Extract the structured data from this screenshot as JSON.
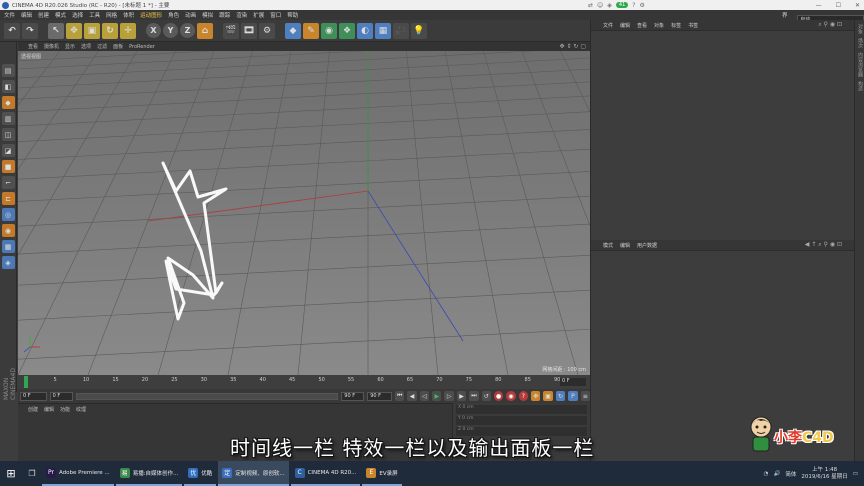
{
  "window": {
    "title": "CINEMA 4D R20.026 Studio (RC - R20) - [未标题 1 *] - 主要"
  },
  "menu": {
    "items": [
      "文件",
      "编辑",
      "创建",
      "模式",
      "选择",
      "工具",
      "网格",
      "体积",
      "运动图形",
      "角色",
      "动画",
      "模拟",
      "跟踪",
      "渲染",
      "扩展",
      "窗口",
      "帮助"
    ],
    "highlighted": [
      "运动图形",
      "运动图形"
    ],
    "layout_label": "界面:",
    "layout_value": "启动"
  },
  "viewport": {
    "tabs": [
      "查看",
      "摄像机",
      "显示",
      "选项",
      "过滤",
      "面板",
      "ProRender"
    ],
    "label": "透视视图",
    "grid_spacing": "网格间距 : 100 cm"
  },
  "timeline": {
    "ticks": [
      "0",
      "5",
      "10",
      "15",
      "20",
      "25",
      "30",
      "35",
      "40",
      "45",
      "50",
      "55",
      "60",
      "65",
      "70",
      "75",
      "80",
      "85",
      "90"
    ],
    "current_frame": "0 F",
    "start_frame": "0 F",
    "range_start": "0 F",
    "range_end": "90 F",
    "end_frame": "90 F",
    "slider_value": "1"
  },
  "material_panel": {
    "tabs": [
      "创建",
      "编辑",
      "功能",
      "纹理"
    ]
  },
  "coords_panel": {
    "rows": [
      "X  0 cm",
      "Y  0 cm",
      "Z  0 cm"
    ]
  },
  "object_panel": {
    "tabs": [
      "文件",
      "编辑",
      "查看",
      "对象",
      "标签",
      "书签"
    ]
  },
  "attribute_panel": {
    "tabs": [
      "模式",
      "编辑",
      "用户数据"
    ]
  },
  "side_strip": {
    "labels": [
      "对象",
      "场次",
      "内容浏览器",
      "构造"
    ]
  },
  "subtitle": "时间线一栏 特效一栏以及输出面板一栏",
  "watermark": {
    "text_main": "小李",
    "text_c4d": "C4D"
  },
  "taskbar": {
    "tasks": [
      {
        "label": "Adobe Premiere ...",
        "icon": "Pr",
        "color": "#2a1a4a"
      },
      {
        "label": "易播:自媒体创作...",
        "icon": "易",
        "color": "#3a8a4a"
      },
      {
        "label": "优酷",
        "icon": "优",
        "color": "#2f6fbf"
      },
      {
        "label": "定制视频、原创软...",
        "icon": "定",
        "color": "#3a6fbf"
      },
      {
        "label": "CINEMA 4D R20...",
        "icon": "C",
        "color": "#2f5f9f"
      },
      {
        "label": "EV录屏",
        "icon": "E",
        "color": "#c9852c"
      }
    ],
    "ime": "简体",
    "time": "上午 1:48",
    "date": "2019/6/16 星期日"
  },
  "toolbar": {
    "axis_labels": [
      "X",
      "Y",
      "Z"
    ]
  },
  "colors": {
    "accent_green": "#2fa84f",
    "viewport_bg": "#7a7a7a",
    "subtitle_text": "#ffffff",
    "watermark_red": "#e23b2a"
  }
}
